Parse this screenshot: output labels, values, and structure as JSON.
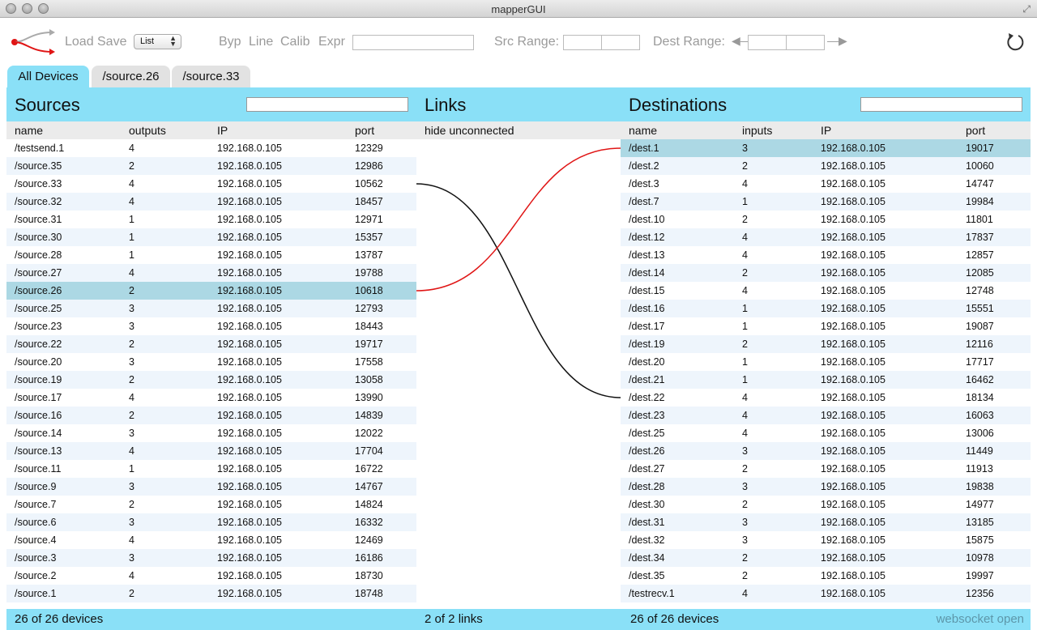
{
  "window": {
    "title": "mapperGUI"
  },
  "toolbar": {
    "load_label": "Load",
    "save_label": "Save",
    "view_select_value": "List",
    "byp_label": "Byp",
    "line_label": "Line",
    "calib_label": "Calib",
    "expr_label": "Expr",
    "expr_value": "",
    "src_range_label": "Src Range:",
    "dest_range_label": "Dest Range:"
  },
  "tabs": [
    {
      "label": "All Devices",
      "active": true
    },
    {
      "label": "/source.26",
      "active": false
    },
    {
      "label": "/source.33",
      "active": false
    }
  ],
  "sources": {
    "title": "Sources",
    "filter_value": "",
    "columns": [
      "name",
      "outputs",
      "IP",
      "port"
    ],
    "rows": [
      [
        "/testsend.1",
        "4",
        "192.168.0.105",
        "12329"
      ],
      [
        "/source.35",
        "2",
        "192.168.0.105",
        "12986"
      ],
      [
        "/source.33",
        "4",
        "192.168.0.105",
        "10562"
      ],
      [
        "/source.32",
        "4",
        "192.168.0.105",
        "18457"
      ],
      [
        "/source.31",
        "1",
        "192.168.0.105",
        "12971"
      ],
      [
        "/source.30",
        "1",
        "192.168.0.105",
        "15357"
      ],
      [
        "/source.28",
        "1",
        "192.168.0.105",
        "13787"
      ],
      [
        "/source.27",
        "4",
        "192.168.0.105",
        "19788"
      ],
      [
        "/source.26",
        "2",
        "192.168.0.105",
        "10618"
      ],
      [
        "/source.25",
        "3",
        "192.168.0.105",
        "12793"
      ],
      [
        "/source.23",
        "3",
        "192.168.0.105",
        "18443"
      ],
      [
        "/source.22",
        "2",
        "192.168.0.105",
        "19717"
      ],
      [
        "/source.20",
        "3",
        "192.168.0.105",
        "17558"
      ],
      [
        "/source.19",
        "2",
        "192.168.0.105",
        "13058"
      ],
      [
        "/source.17",
        "4",
        "192.168.0.105",
        "13990"
      ],
      [
        "/source.16",
        "2",
        "192.168.0.105",
        "14839"
      ],
      [
        "/source.14",
        "3",
        "192.168.0.105",
        "12022"
      ],
      [
        "/source.13",
        "4",
        "192.168.0.105",
        "17704"
      ],
      [
        "/source.11",
        "1",
        "192.168.0.105",
        "16722"
      ],
      [
        "/source.9",
        "3",
        "192.168.0.105",
        "14767"
      ],
      [
        "/source.7",
        "2",
        "192.168.0.105",
        "14824"
      ],
      [
        "/source.6",
        "3",
        "192.168.0.105",
        "16332"
      ],
      [
        "/source.4",
        "4",
        "192.168.0.105",
        "12469"
      ],
      [
        "/source.3",
        "3",
        "192.168.0.105",
        "16186"
      ],
      [
        "/source.2",
        "4",
        "192.168.0.105",
        "18730"
      ],
      [
        "/source.1",
        "2",
        "192.168.0.105",
        "18748"
      ]
    ],
    "selected_row": 8,
    "footer": "26 of 26 devices"
  },
  "links": {
    "title": "Links",
    "hide_unconnected_label": "hide unconnected",
    "footer": "2 of 2 links",
    "connections": [
      {
        "from": "/source.33",
        "to": "/dest.22",
        "color": "#111111"
      },
      {
        "from": "/source.26",
        "to": "/dest.1",
        "color": "#e01515"
      }
    ]
  },
  "destinations": {
    "title": "Destinations",
    "filter_value": "",
    "columns": [
      "name",
      "inputs",
      "IP",
      "port"
    ],
    "rows": [
      [
        "/dest.1",
        "3",
        "192.168.0.105",
        "19017"
      ],
      [
        "/dest.2",
        "2",
        "192.168.0.105",
        "10060"
      ],
      [
        "/dest.3",
        "4",
        "192.168.0.105",
        "14747"
      ],
      [
        "/dest.7",
        "1",
        "192.168.0.105",
        "19984"
      ],
      [
        "/dest.10",
        "2",
        "192.168.0.105",
        "11801"
      ],
      [
        "/dest.12",
        "4",
        "192.168.0.105",
        "17837"
      ],
      [
        "/dest.13",
        "4",
        "192.168.0.105",
        "12857"
      ],
      [
        "/dest.14",
        "2",
        "192.168.0.105",
        "12085"
      ],
      [
        "/dest.15",
        "4",
        "192.168.0.105",
        "12748"
      ],
      [
        "/dest.16",
        "1",
        "192.168.0.105",
        "15551"
      ],
      [
        "/dest.17",
        "1",
        "192.168.0.105",
        "19087"
      ],
      [
        "/dest.19",
        "2",
        "192.168.0.105",
        "12116"
      ],
      [
        "/dest.20",
        "1",
        "192.168.0.105",
        "17717"
      ],
      [
        "/dest.21",
        "1",
        "192.168.0.105",
        "16462"
      ],
      [
        "/dest.22",
        "4",
        "192.168.0.105",
        "18134"
      ],
      [
        "/dest.23",
        "4",
        "192.168.0.105",
        "16063"
      ],
      [
        "/dest.25",
        "4",
        "192.168.0.105",
        "13006"
      ],
      [
        "/dest.26",
        "3",
        "192.168.0.105",
        "11449"
      ],
      [
        "/dest.27",
        "2",
        "192.168.0.105",
        "11913"
      ],
      [
        "/dest.28",
        "3",
        "192.168.0.105",
        "19838"
      ],
      [
        "/dest.30",
        "2",
        "192.168.0.105",
        "14977"
      ],
      [
        "/dest.31",
        "3",
        "192.168.0.105",
        "13185"
      ],
      [
        "/dest.32",
        "3",
        "192.168.0.105",
        "15875"
      ],
      [
        "/dest.34",
        "2",
        "192.168.0.105",
        "10978"
      ],
      [
        "/dest.35",
        "2",
        "192.168.0.105",
        "19997"
      ],
      [
        "/testrecv.1",
        "4",
        "192.168.0.105",
        "12356"
      ]
    ],
    "selected_row": 0,
    "footer": "26 of 26 devices"
  },
  "status": {
    "websocket": "websocket open"
  },
  "colors": {
    "accent": "#8ae0f7",
    "selected_row": "#acd8e4",
    "link_selected": "#e01515",
    "link": "#111111"
  }
}
